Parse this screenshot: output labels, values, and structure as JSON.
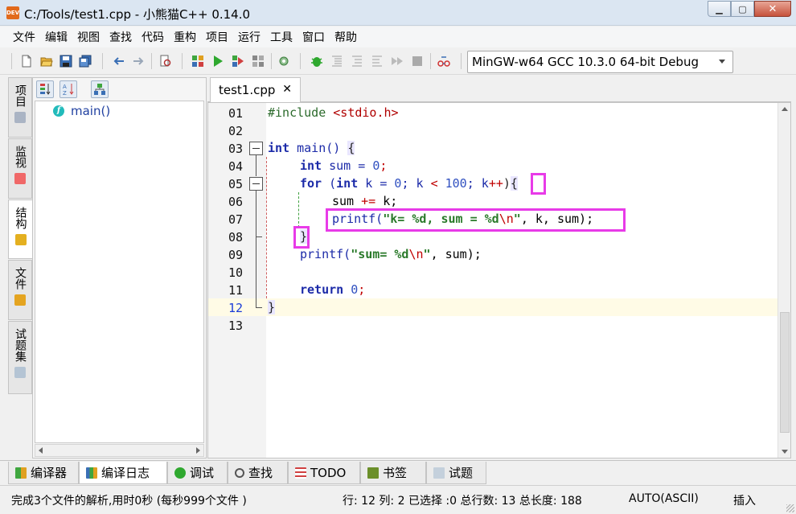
{
  "window": {
    "icon_text": "DEV",
    "title": "C:/Tools/test1.cpp - 小熊猫C++ 0.14.0",
    "minimize": "▁",
    "maximize": "▢",
    "close": "✕"
  },
  "menu": [
    "文件",
    "编辑",
    "视图",
    "查找",
    "代码",
    "重构",
    "项目",
    "运行",
    "工具",
    "窗口",
    "帮助"
  ],
  "toolbar": {
    "compiler": "MinGW-w64 GCC 10.3.0 64-bit Debug"
  },
  "left_tabs": [
    "项目",
    "监视",
    "结构",
    "文件",
    "试题集"
  ],
  "structure": {
    "items": [
      {
        "icon": "f",
        "label": "main()"
      }
    ]
  },
  "editor": {
    "tab_label": "test1.cpp",
    "tab_close": "✕",
    "current_line": 12,
    "line_numbers": [
      "01",
      "02",
      "03",
      "04",
      "05",
      "06",
      "07",
      "08",
      "09",
      "10",
      "11",
      "12",
      "13"
    ],
    "code": {
      "l1_include": "#include ",
      "l1_header": "<stdio.h>",
      "l3_int": "int",
      "l3_main": " main() ",
      "l3_open": "{",
      "l4_int": "int",
      "l4_rest": " sum = ",
      "l4_zero": "0",
      "l4_semi": ";",
      "l5_for": "for",
      "l5_paren": " (",
      "l5_int": "int",
      "l5_k": " k = ",
      "l5_zero": "0",
      "l5_cond": "; k ",
      "l5_lt": "<",
      "l5_sp": " ",
      "l5_hundred": "100",
      "l5_inc": "; k",
      "l5_pp": "++",
      "l5_close": ")",
      "l5_brace": "{",
      "l6_sum": "sum ",
      "l6_op": "+=",
      "l6_rest": " k;",
      "l7_printf": "printf(",
      "l7_str1": "\"k= %d, sum = %d",
      "l7_esc": "\\n",
      "l7_str2": "\"",
      "l7_rest": ", k, sum);",
      "l8_brace": "}",
      "l9_printf": "printf(",
      "l9_str1": "\"sum= %d",
      "l9_esc": "\\n",
      "l9_str2": "\"",
      "l9_rest": ", sum);",
      "l11_return": "return",
      "l11_sp": " ",
      "l11_zero": "0",
      "l11_semi": ";",
      "l12_brace": "}"
    }
  },
  "bottom_tabs": [
    "编译器",
    "编译日志",
    "调试",
    "查找",
    "TODO",
    "书签",
    "试题"
  ],
  "status": {
    "message": "完成3个文件的解析,用时0秒 (每秒999个文件 )",
    "position": "行: 12 列: 2 已选择 :0 总行数: 13 总长度: 188",
    "encoding": "AUTO(ASCII)",
    "mode": "插入"
  },
  "colors": {
    "highlight_box": "#e83be8",
    "keyword": "#1b2aa8",
    "string": "#2a7a2a",
    "escape": "#c00000"
  }
}
